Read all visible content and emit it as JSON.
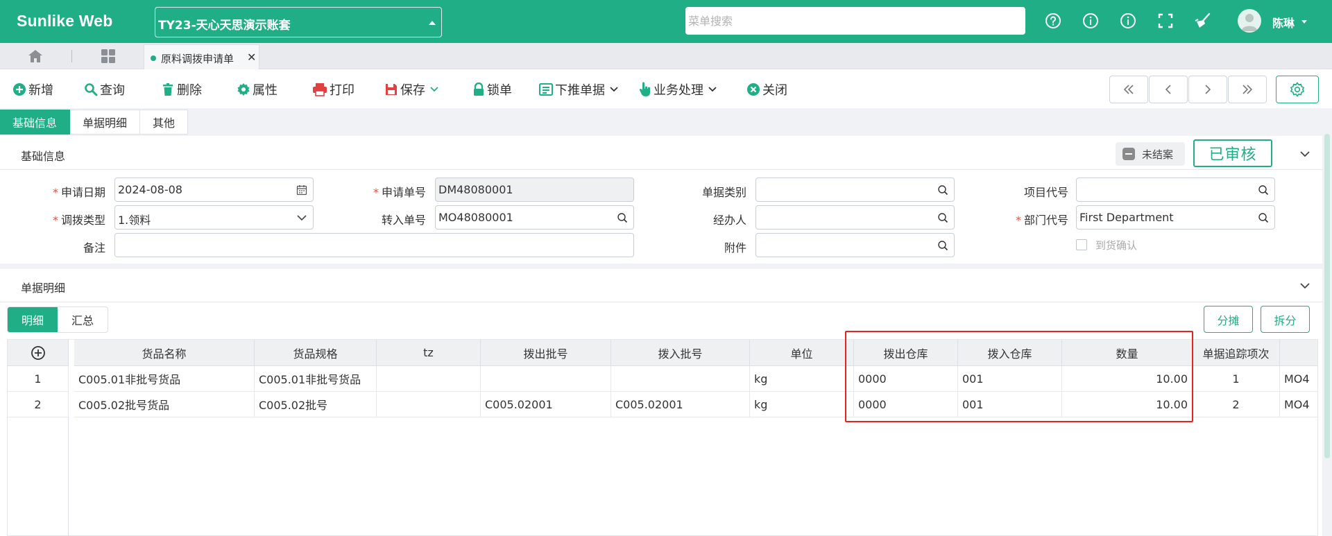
{
  "app": {
    "logo": "Sunlike Web",
    "account_set": "TY23-天心天思演示账套",
    "user_name": "陈琳"
  },
  "search": {
    "placeholder": "菜单搜索"
  },
  "top_icons": [
    "help-icon",
    "info-icon",
    "about-icon",
    "fullscreen-icon",
    "broom-icon"
  ],
  "tabs": {
    "doc_tab_label": "原料调拨申请单"
  },
  "toolbar": {
    "new": "新增",
    "query": "查询",
    "delete": "删除",
    "props": "属性",
    "print": "打印",
    "save": "保存",
    "lock": "锁单",
    "push_down": "下推单据",
    "business": "业务处理",
    "close": "关闭",
    "nav": [
      "«",
      "‹",
      "›",
      "»"
    ]
  },
  "section_tabs": [
    "基础信息",
    "单据明细",
    "其他"
  ],
  "basic": {
    "title": "基础信息",
    "status": "未结案",
    "approved": "已审核",
    "fields": {
      "apply_date_label": "申请日期",
      "apply_date": "2024-08-08",
      "apply_no_label": "申请单号",
      "apply_no": "DM48080001",
      "doc_type_label": "单据类别",
      "doc_type": "",
      "project_label": "项目代号",
      "project": "",
      "transfer_type_label": "调拨类型",
      "transfer_type": "1.领料",
      "in_no_label": "转入单号",
      "in_no": "MO48080001",
      "handler_label": "经办人",
      "handler": "",
      "dept_label": "部门代号",
      "dept": "First Department",
      "remark_label": "备注",
      "remark": "",
      "attach_label": "附件",
      "attach": "",
      "arrival_label": "到货确认"
    }
  },
  "detail": {
    "title": "单据明细",
    "subtabs": [
      "明细",
      "汇总"
    ],
    "actions": [
      "分摊",
      "拆分"
    ],
    "columns": [
      "货品名称",
      "货品规格",
      "tz",
      "拨出批号",
      "拨入批号",
      "单位",
      "拨出仓库",
      "拨入仓库",
      "数量",
      "单据追踪项次"
    ],
    "rows": [
      {
        "idx": "1",
        "name": "C005.01非批号货品",
        "spec": "C005.01非批号货品",
        "tz": "",
        "out_batch": "",
        "in_batch": "",
        "unit": "kg",
        "out_wh": "0000",
        "in_wh": "001",
        "qty": "10.00",
        "trace": "1",
        "extra": "MO4"
      },
      {
        "idx": "2",
        "name": "C005.02批号货品",
        "spec": "C005.02批号",
        "tz": "",
        "out_batch": "C005.02001",
        "in_batch": "C005.02001",
        "unit": "kg",
        "out_wh": "0000",
        "in_wh": "001",
        "qty": "10.00",
        "trace": "2",
        "extra": "MO4"
      }
    ]
  },
  "colors": {
    "brand": "#1fae85",
    "highlight": "#e8231d",
    "required": "#e74c3c"
  }
}
